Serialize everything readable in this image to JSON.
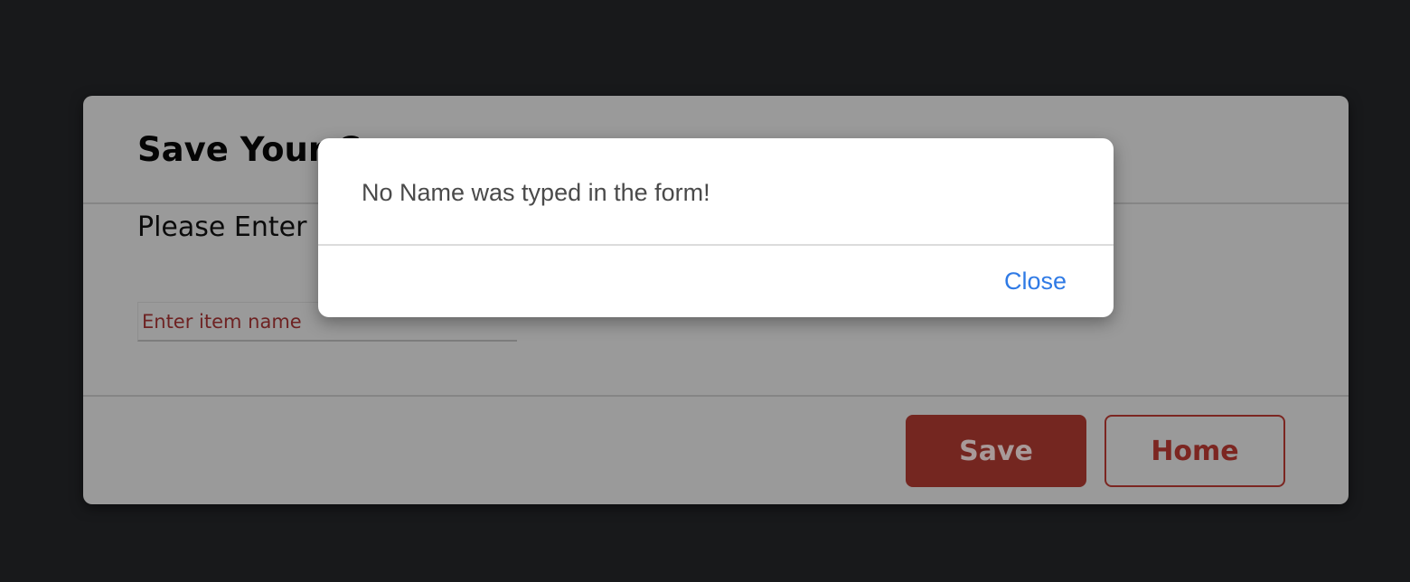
{
  "form": {
    "title": "Save Your C",
    "prompt": "Please Enter",
    "input": {
      "value": "",
      "placeholder": "Enter item name"
    },
    "buttons": {
      "save_label": "Save",
      "home_label": "Home"
    }
  },
  "alert": {
    "message": "No Name was typed in the form!",
    "close_label": "Close"
  },
  "colors": {
    "background": "#18191b",
    "card": "#9a9a9a",
    "accent": "#742620",
    "link": "#2f7ae5"
  }
}
